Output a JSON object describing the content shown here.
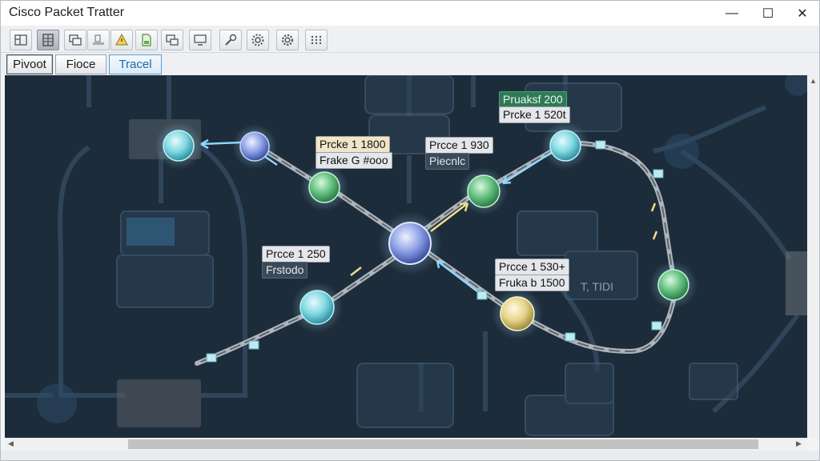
{
  "window": {
    "title": "Cisco Packet Tratter",
    "minimize": "—",
    "maximize": "☐",
    "close": "✕"
  },
  "toolbar": {
    "tools": [
      {
        "name": "layout-icon",
        "active": false
      },
      {
        "name": "grid-select-icon",
        "active": true
      },
      {
        "name": "copy-icon",
        "active": false
      },
      {
        "name": "device-icon",
        "active": false
      },
      {
        "name": "warning-icon",
        "active": false
      },
      {
        "name": "document-icon",
        "active": false
      },
      {
        "name": "windows-icon",
        "active": false
      },
      {
        "name": "monitor-icon",
        "active": false
      },
      {
        "name": "link-tool-icon",
        "active": false
      },
      {
        "name": "settings-gear-icon",
        "active": false
      },
      {
        "name": "options-gear-icon",
        "active": false
      },
      {
        "name": "grid-dots-icon",
        "active": false
      }
    ]
  },
  "modes": {
    "pivot": "Pivoot",
    "fioce": "Fioce",
    "tracel": "Tracel"
  },
  "labels": {
    "top_green": "Pruaksf 200",
    "top_right": "Prcke 1 520t",
    "upper_left_1": "Prcke 1 1800",
    "upper_left_2": "Frake G #ooo",
    "mid_1": "Prcce 1 930",
    "mid_2": "Piecnlc",
    "left_1": "Prcce 1 250",
    "left_2": "Frstodo",
    "right_1": "Prcce 1 530+",
    "right_2": "Fruka b 1500",
    "right_ghost": "T, TIDI"
  },
  "colors": {
    "canvas_bg": "#1d2c3a",
    "node_cyan": "#8fe3ea",
    "node_green": "#6fd08a",
    "node_blue": "#8fa3e6",
    "node_gold": "#e8d98c"
  }
}
